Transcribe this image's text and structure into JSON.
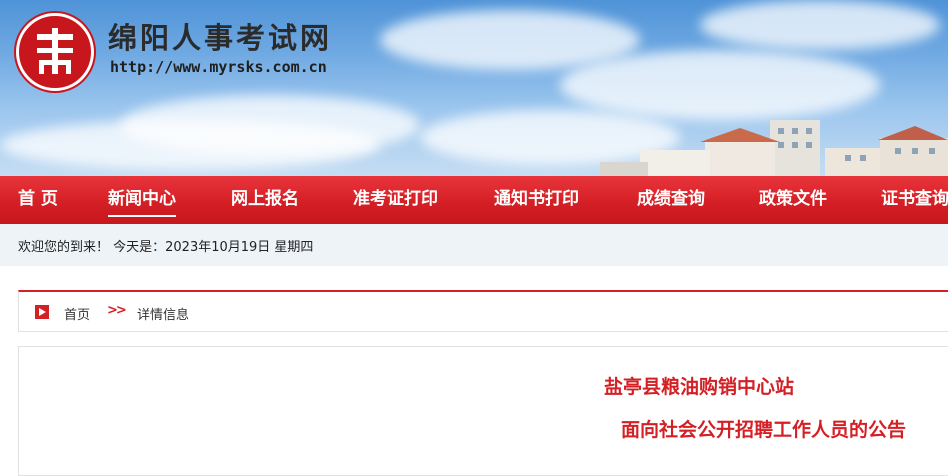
{
  "header": {
    "site_title": "绵阳人事考试网",
    "site_url": "http://www.myrsks.com.cn",
    "logo_icon": "seal-logo-icon"
  },
  "nav": {
    "items": [
      {
        "label": "首 页",
        "active": false
      },
      {
        "label": "新闻中心",
        "active": true
      },
      {
        "label": "网上报名",
        "active": false
      },
      {
        "label": "准考证打印",
        "active": false
      },
      {
        "label": "通知书打印",
        "active": false
      },
      {
        "label": "成绩查询",
        "active": false
      },
      {
        "label": "政策文件",
        "active": false
      },
      {
        "label": "证书查询",
        "active": false
      }
    ]
  },
  "welcome": {
    "text": "欢迎您的到来！ 今天是：2023年10月19日 星期四"
  },
  "breadcrumb": {
    "icon": "play-arrow-icon",
    "home": "首页",
    "separator": ">>",
    "current": "详情信息"
  },
  "article": {
    "title_line1": "盐亭县粮油购销中心站",
    "title_line2": "面向社会公开招聘工作人员的公告"
  },
  "colors": {
    "brand_red": "#d41f25",
    "welcome_bg": "#eef3f8",
    "sky_blue": "#6fa9e2"
  }
}
